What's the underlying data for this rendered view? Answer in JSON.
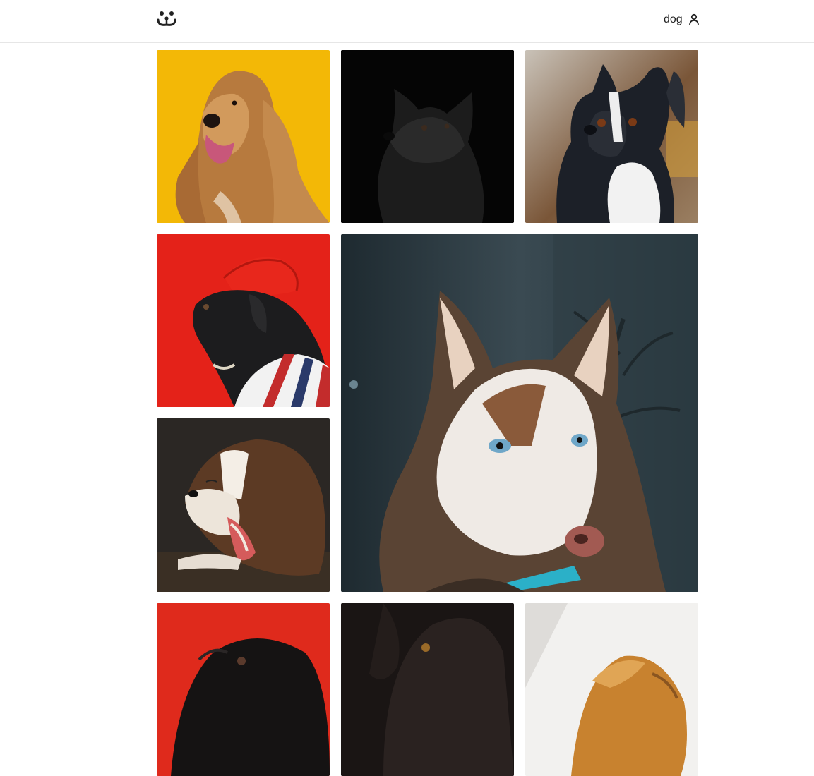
{
  "header": {
    "logo_icon": "smiling-dog-face-icon",
    "username": "dog",
    "user_icon": "person-icon"
  },
  "gallery": {
    "photos": [
      {
        "subject": "afghan-hound",
        "bg": "#f2b705"
      },
      {
        "subject": "black-spitz",
        "bg": "#050505"
      },
      {
        "subject": "boston-terrier",
        "bg": "#8a7a6a"
      },
      {
        "subject": "pug-with-red-beret",
        "bg": "#e3231a"
      },
      {
        "subject": "siberian-husky",
        "bg": "#2c3a40"
      },
      {
        "subject": "yawning-puppy",
        "bg": "#2b2724"
      },
      {
        "subject": "black-pug-on-red",
        "bg": "#df2a1c"
      },
      {
        "subject": "black-labrador",
        "bg": "#1a1514"
      },
      {
        "subject": "tan-dog",
        "bg": "#f1f1f1"
      }
    ]
  }
}
